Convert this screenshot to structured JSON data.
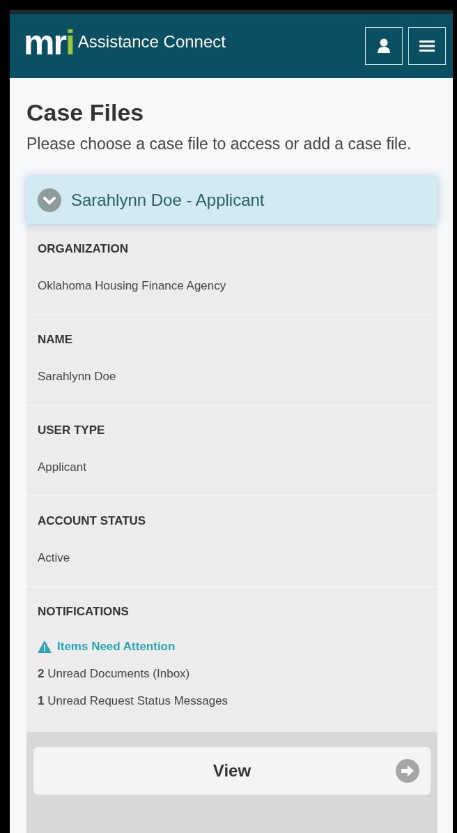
{
  "header": {
    "logo": [
      {
        "text": "mr",
        "color": "#ffffff"
      },
      {
        "text": "i",
        "color": "#9cc43c"
      }
    ],
    "app_name": "Assistance Connect"
  },
  "page": {
    "title": "Case Files",
    "subtitle": "Please choose a case file to access or add a case file."
  },
  "case_file": {
    "title": "Sarahlynn Doe - Applicant",
    "expanded": true,
    "fields": [
      {
        "label": "ORGANIZATION",
        "value": "Oklahoma Housing Finance Agency"
      },
      {
        "label": "NAME",
        "value": "Sarahlynn Doe"
      },
      {
        "label": "USER TYPE",
        "value": "Applicant"
      },
      {
        "label": "ACCOUNT STATUS",
        "value": "Active"
      }
    ],
    "notifications": {
      "label": "NOTIFICATIONS",
      "items": [
        {
          "kind": "alert",
          "text": "**Items Need Attention**"
        },
        {
          "kind": "count",
          "text": "**2** Unread Documents (Inbox)"
        },
        {
          "kind": "count",
          "text": "**1** Unread Request Status Messages"
        }
      ]
    },
    "button": "View"
  }
}
